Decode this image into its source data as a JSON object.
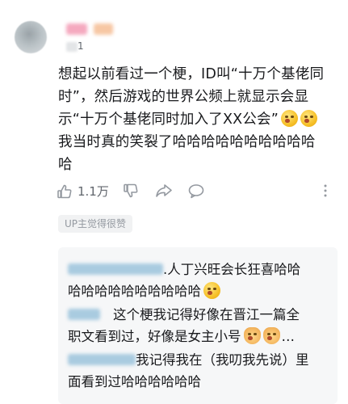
{
  "comment": {
    "level_digit": "1",
    "lines": [
      "想起以前看过一个梗，ID叫“十万个基佬同",
      "时”，然后游戏的世界公频上就显示会显",
      "示“十万个基佬同时加入了XX公会”",
      "我当时真的笑裂了哈哈哈哈哈哈哈哈哈哈",
      "哈"
    ],
    "emojis": [
      "laughing-cat-emoji",
      "laughing-cat-emoji"
    ],
    "like_count": "1.1万"
  },
  "badge": {
    "label": "UP主觉得很赞"
  },
  "replies": [
    {
      "line1": ".人丁兴旺会长狂喜哈哈",
      "line2": "哈哈哈哈哈哈哈哈哈哈",
      "emoji": "grinning-emoji"
    },
    {
      "line1": "这个梗我记得好像在晋江一篇全",
      "line2": "职文看到过，好像是女主小号",
      "ellipsis": "…",
      "emojis": [
        "cat-face-emoji",
        "cat-face-emoji"
      ]
    },
    {
      "line1": "我记得我在（我叨我先说）里",
      "line2": "面看到过哈哈哈哈哈哈"
    }
  ],
  "colors": {
    "text": "#18191c",
    "secondary": "#9499a0",
    "reply_bg": "#f6f7f8",
    "badge_bg": "#f1f2f3"
  }
}
